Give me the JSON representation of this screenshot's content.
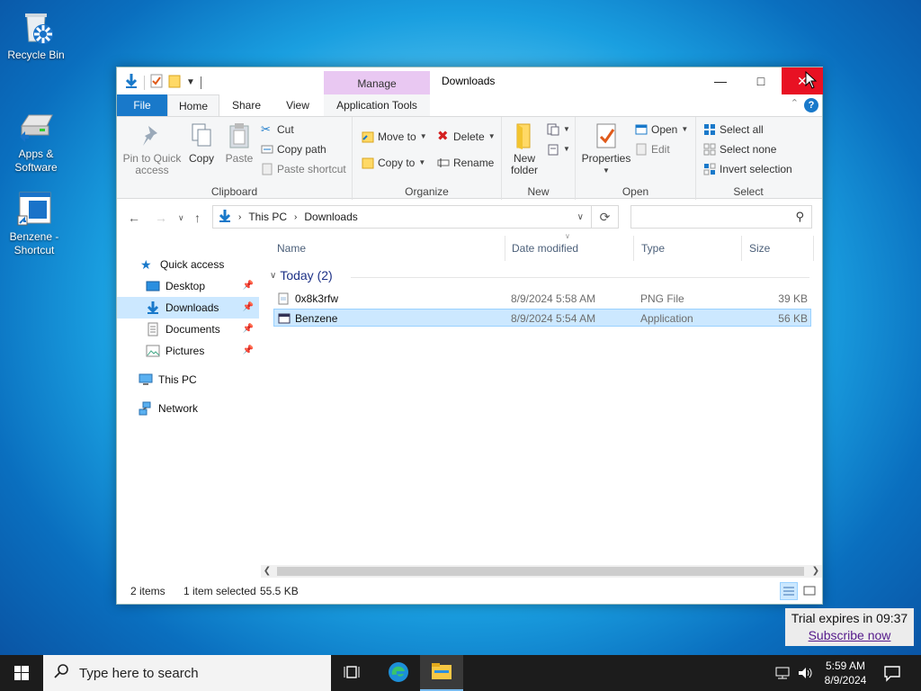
{
  "desktop": {
    "icons": [
      {
        "label": "Recycle Bin",
        "icon": "recycle-bin-icon"
      },
      {
        "label": "Apps & Software",
        "icon": "drive-icon"
      },
      {
        "label": "Benzene - Shortcut",
        "icon": "app-shortcut-icon"
      }
    ]
  },
  "window": {
    "title": "Downloads",
    "contextual_tab_group": "Manage",
    "tabs": [
      "File",
      "Home",
      "Share",
      "View",
      "Application Tools"
    ],
    "ribbon": {
      "clipboard": {
        "label": "Clipboard",
        "pin": "Pin to Quick access",
        "copy": "Copy",
        "paste": "Paste",
        "cut": "Cut",
        "copy_path": "Copy path",
        "paste_shortcut": "Paste shortcut"
      },
      "organize": {
        "label": "Organize",
        "move_to": "Move to",
        "copy_to": "Copy to",
        "delete": "Delete",
        "rename": "Rename"
      },
      "new": {
        "label": "New",
        "new_folder": "New folder"
      },
      "open": {
        "label": "Open",
        "properties": "Properties",
        "open": "Open",
        "edit": "Edit"
      },
      "select": {
        "label": "Select",
        "select_all": "Select all",
        "select_none": "Select none",
        "invert": "Invert selection"
      }
    },
    "address": {
      "segments": [
        "This PC",
        "Downloads"
      ]
    },
    "search": {
      "placeholder": ""
    },
    "nav": {
      "quick_access": "Quick access",
      "items": [
        "Desktop",
        "Downloads",
        "Documents",
        "Pictures"
      ],
      "this_pc": "This PC",
      "network": "Network"
    },
    "columns": [
      "Name",
      "Date modified",
      "Type",
      "Size"
    ],
    "group": "Today (2)",
    "files": [
      {
        "name": "0x8k3rfw",
        "date": "8/9/2024 5:58 AM",
        "type": "PNG File",
        "size": "39 KB"
      },
      {
        "name": "Benzene",
        "date": "8/9/2024 5:54 AM",
        "type": "Application",
        "size": "56 KB"
      }
    ],
    "status": {
      "count": "2 items",
      "selected": "1 item selected",
      "size": "55.5 KB"
    }
  },
  "taskbar": {
    "search_placeholder": "Type here to search",
    "time": "5:59 AM",
    "date": "8/9/2024"
  },
  "trial": {
    "text": "Trial expires in 09:37",
    "link": "Subscribe now"
  },
  "colors": {
    "accent": "#1979ca",
    "selection": "#cce8ff",
    "manage_tab": "#e9c8f2",
    "close": "#e81123"
  }
}
